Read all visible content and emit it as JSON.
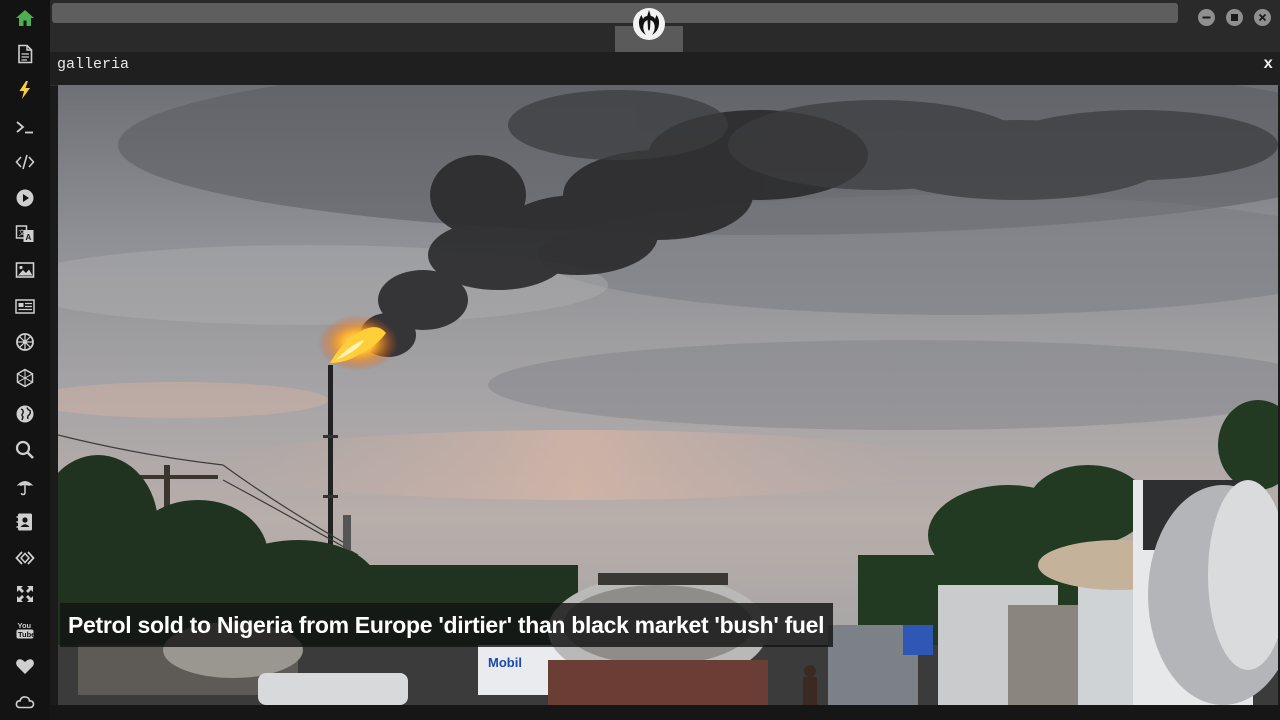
{
  "window": {
    "panel_title": "galleria",
    "close_label": "x"
  },
  "topbar": {
    "logo_icon": "rebel-alliance-icon",
    "buttons": [
      "minimize-icon",
      "maximize-icon",
      "close-icon"
    ]
  },
  "sidebar": {
    "items": [
      {
        "name": "home-icon",
        "color": "#4caf50"
      },
      {
        "name": "document-icon",
        "color": "#cfcfcf"
      },
      {
        "name": "lightning-icon",
        "color": "#f5d142"
      },
      {
        "name": "terminal-icon",
        "color": "#cfcfcf"
      },
      {
        "name": "code-icon",
        "color": "#cfcfcf"
      },
      {
        "name": "play-icon",
        "color": "#cfcfcf"
      },
      {
        "name": "translate-icon",
        "color": "#cfcfcf"
      },
      {
        "name": "image-icon",
        "color": "#cfcfcf"
      },
      {
        "name": "newspaper-icon",
        "color": "#cfcfcf"
      },
      {
        "name": "settings-wheel-icon",
        "color": "#cfcfcf"
      },
      {
        "name": "hexagon-network-icon",
        "color": "#cfcfcf"
      },
      {
        "name": "globe-icon",
        "color": "#cfcfcf"
      },
      {
        "name": "search-icon",
        "color": "#cfcfcf"
      },
      {
        "name": "umbrella-icon",
        "color": "#cfcfcf"
      },
      {
        "name": "contact-book-icon",
        "color": "#cfcfcf"
      },
      {
        "name": "dev-icon",
        "color": "#cfcfcf"
      },
      {
        "name": "expand-arrows-icon",
        "color": "#cfcfcf"
      },
      {
        "name": "youtube-icon",
        "color": "#cfcfcf"
      },
      {
        "name": "heart-icon",
        "color": "#cfcfcf"
      },
      {
        "name": "cloud-icon",
        "color": "#cfcfcf"
      }
    ]
  },
  "gallery": {
    "caption": "Petrol sold to Nigeria from Europe 'dirtier' than black market 'bush' fuel",
    "photo_label": "Mobil"
  }
}
